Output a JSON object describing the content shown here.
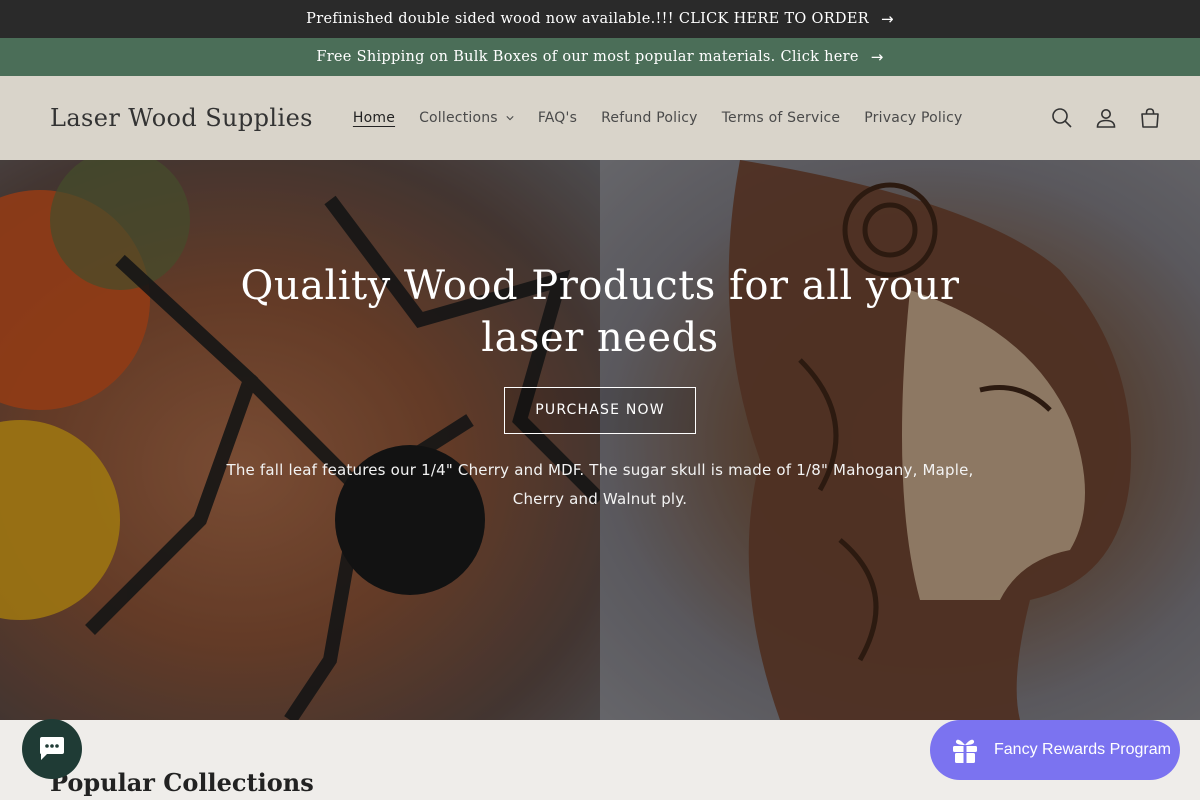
{
  "announcements": [
    {
      "text": "Prefinished double sided wood now available.!!! CLICK HERE TO ORDER",
      "arrow": "→"
    },
    {
      "text": "Free Shipping on Bulk Boxes of our most popular materials. Click here",
      "arrow": "→"
    }
  ],
  "header": {
    "logo": "Laser Wood Supplies",
    "nav": [
      {
        "label": "Home",
        "active": true
      },
      {
        "label": "Collections",
        "dropdown": true
      },
      {
        "label": "FAQ's"
      },
      {
        "label": "Refund Policy"
      },
      {
        "label": "Terms of Service"
      },
      {
        "label": "Privacy Policy"
      }
    ],
    "icons": [
      "search-icon",
      "account-icon",
      "cart-icon"
    ]
  },
  "hero": {
    "title": "Quality Wood Products for all your laser needs",
    "button": "PURCHASE NOW",
    "text": "The fall leaf features our 1/4\" Cherry and MDF. The sugar skull is made of 1/8\" Mahogany, Maple, Cherry and Walnut ply."
  },
  "section": {
    "title": "Popular Collections"
  },
  "widgets": {
    "chat_icon": "chat-icon",
    "rewards_label": "Fancy Rewards Program",
    "rewards_icon": "gift-icon"
  },
  "colors": {
    "announcement_dark": "#2a2a2a",
    "announcement_green": "#4b6e58",
    "header_bg": "#d9d4ca",
    "page_bg": "#efedea",
    "chat_bg": "#1f3b35",
    "rewards_bg": "#7b73f0"
  }
}
